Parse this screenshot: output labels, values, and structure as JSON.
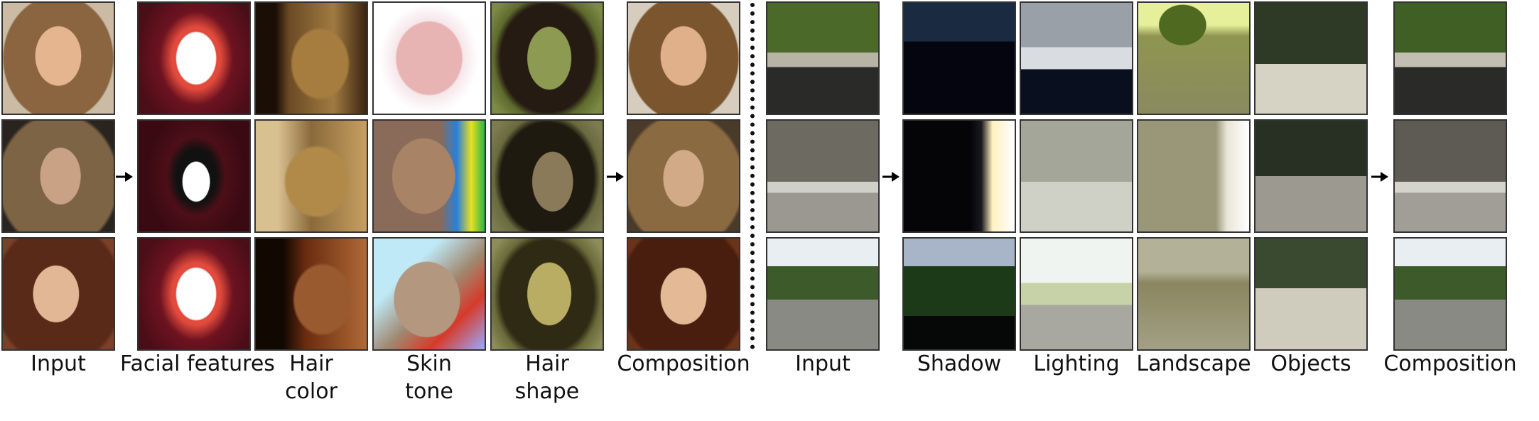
{
  "face_panel": {
    "labels": {
      "input": "Input",
      "facial_features": "Facial features",
      "hair_color": "Hair\ncolor",
      "skin_tone": "Skin\ntone",
      "hair_shape": "Hair\nshape",
      "composition": "Composition"
    }
  },
  "street_panel": {
    "labels": {
      "input": "Input",
      "shadow": "Shadow",
      "lighting": "Lighting",
      "landscape": "Landscape",
      "objects": "Objects",
      "composition": "Composition"
    }
  }
}
